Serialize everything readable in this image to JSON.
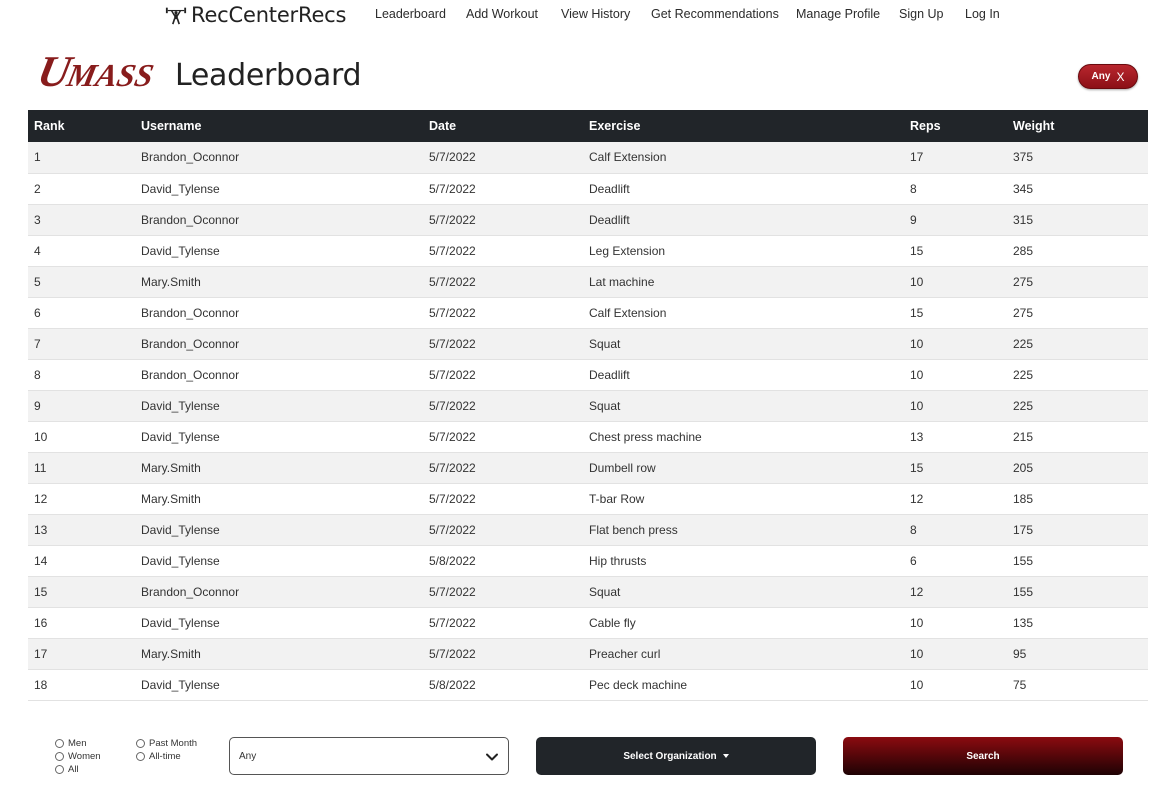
{
  "nav": {
    "brand": "RecCenterRecs",
    "links": [
      "Leaderboard",
      "Add Workout",
      "View History",
      "Get Recommendations",
      "Manage Profile",
      "Sign Up",
      "Log In"
    ]
  },
  "header": {
    "logo_text": "UMASS",
    "title": "Leaderboard",
    "filter_chip": "Any",
    "filter_chip_close": "X"
  },
  "table": {
    "columns": [
      "Rank",
      "Username",
      "Date",
      "Exercise",
      "Reps",
      "Weight"
    ],
    "rows": [
      [
        "1",
        "Brandon_Oconnor",
        "5/7/2022",
        "Calf Extension",
        "17",
        "375"
      ],
      [
        "2",
        "David_Tylense",
        "5/7/2022",
        "Deadlift",
        "8",
        "345"
      ],
      [
        "3",
        "Brandon_Oconnor",
        "5/7/2022",
        "Deadlift",
        "9",
        "315"
      ],
      [
        "4",
        "David_Tylense",
        "5/7/2022",
        "Leg Extension",
        "15",
        "285"
      ],
      [
        "5",
        "Mary.Smith",
        "5/7/2022",
        "Lat machine",
        "10",
        "275"
      ],
      [
        "6",
        "Brandon_Oconnor",
        "5/7/2022",
        "Calf Extension",
        "15",
        "275"
      ],
      [
        "7",
        "Brandon_Oconnor",
        "5/7/2022",
        "Squat",
        "10",
        "225"
      ],
      [
        "8",
        "Brandon_Oconnor",
        "5/7/2022",
        "Deadlift",
        "10",
        "225"
      ],
      [
        "9",
        "David_Tylense",
        "5/7/2022",
        "Squat",
        "10",
        "225"
      ],
      [
        "10",
        "David_Tylense",
        "5/7/2022",
        "Chest press machine",
        "13",
        "215"
      ],
      [
        "11",
        "Mary.Smith",
        "5/7/2022",
        "Dumbell row",
        "15",
        "205"
      ],
      [
        "12",
        "Mary.Smith",
        "5/7/2022",
        "T-bar Row",
        "12",
        "185"
      ],
      [
        "13",
        "David_Tylense",
        "5/7/2022",
        "Flat bench press",
        "8",
        "175"
      ],
      [
        "14",
        "David_Tylense",
        "5/8/2022",
        "Hip thrusts",
        "6",
        "155"
      ],
      [
        "15",
        "Brandon_Oconnor",
        "5/7/2022",
        "Squat",
        "12",
        "155"
      ],
      [
        "16",
        "David_Tylense",
        "5/7/2022",
        "Cable fly",
        "10",
        "135"
      ],
      [
        "17",
        "Mary.Smith",
        "5/7/2022",
        "Preacher curl",
        "10",
        "95"
      ],
      [
        "18",
        "David_Tylense",
        "5/8/2022",
        "Pec deck machine",
        "10",
        "75"
      ]
    ]
  },
  "filters": {
    "gender": [
      "Men",
      "Women",
      "All"
    ],
    "period": [
      "Past Month",
      "All-time"
    ],
    "exercise_select": "Any",
    "organization_button": "Select Organization",
    "search_button": "Search"
  },
  "colors": {
    "umass_maroon": "#881c1c",
    "header_dark": "#212529",
    "chip": "#a31b22"
  },
  "icons": {
    "brand": "weightlifter-icon",
    "select": "chevron-down-icon",
    "org": "caret-down-icon"
  }
}
